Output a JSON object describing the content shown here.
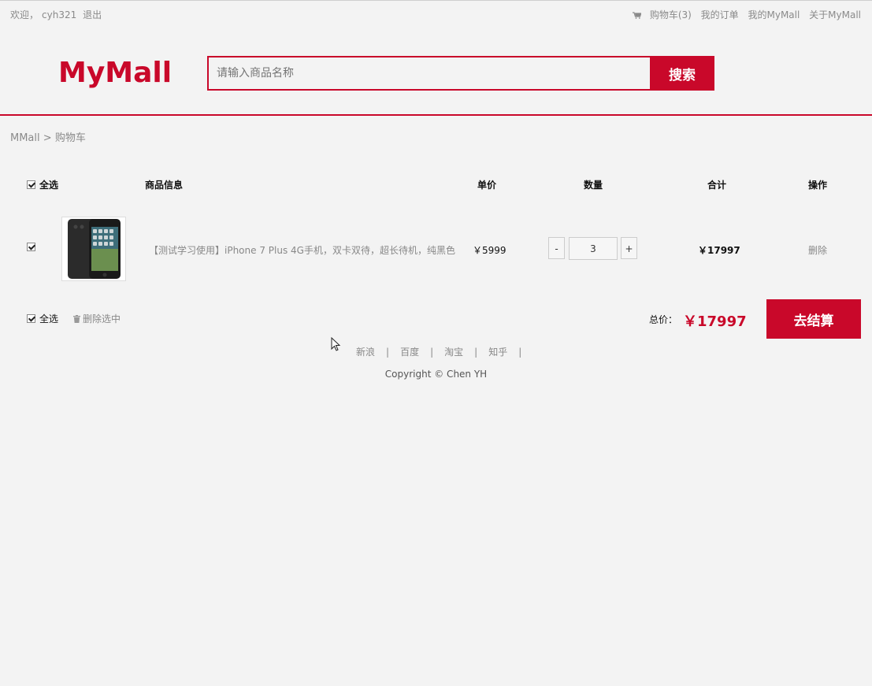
{
  "topbar": {
    "welcome": "欢迎，",
    "username": "cyh321",
    "logout": "退出",
    "cart": "购物车(3)",
    "orders": "我的订单",
    "my_mall": "我的MyMall",
    "about": "关于MyMall"
  },
  "header": {
    "logo": "MyMall",
    "search_placeholder": "请输入商品名称",
    "search_button": "搜索"
  },
  "breadcrumb": {
    "home": "MMall",
    "sep": ">",
    "current": "购物车"
  },
  "cart": {
    "columns": {
      "select_all": "全选",
      "info": "商品信息",
      "unit_price": "单价",
      "quantity": "数量",
      "subtotal": "合计",
      "action": "操作"
    },
    "items": [
      {
        "name": "【测试学习使用】iPhone 7 Plus 4G手机，双卡双待，超长待机，纯黑色",
        "price": "￥5999",
        "quantity": "3",
        "subtotal": "￥17997",
        "delete": "删除",
        "checked": true
      }
    ],
    "footer": {
      "select_all": "全选",
      "delete_selected": "删除选中",
      "total_label": "总价：",
      "total_value": "￥17997",
      "checkout": "去结算"
    }
  },
  "footer": {
    "links": [
      "新浪",
      "百度",
      "淘宝",
      "知乎"
    ],
    "separator": "|",
    "copyright": "Copyright © Chen YH"
  },
  "colors": {
    "brand": "#c9082a",
    "background": "#f3f3f3",
    "muted_text": "#8a8a8a"
  }
}
